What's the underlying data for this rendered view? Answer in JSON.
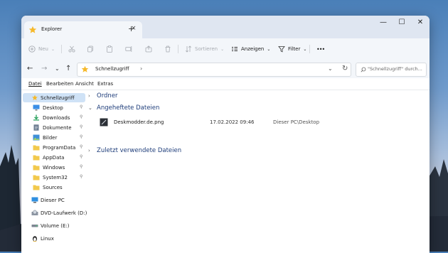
{
  "window": {
    "tab_title": "Explorer",
    "tab_close_glyph": "×",
    "new_tab_glyph": "+",
    "controls": {
      "minimize": "—",
      "maximize": "☐",
      "close": "✕"
    }
  },
  "toolbar": {
    "new_label": "Neu",
    "sort_label": "Sortieren",
    "view_label": "Anzeigen",
    "filter_label": "Filter",
    "more_label": "•••",
    "caret": "⌄"
  },
  "address": {
    "back": "←",
    "forward": "→",
    "dropdown": "⌄",
    "up": "↑",
    "path": "Schnellzugriff",
    "path_chevron": "›",
    "field_dropdown": "⌄",
    "refresh": "↻",
    "search_placeholder": "\"Schnellzugriff\" durch..."
  },
  "menubar": [
    "Datei",
    "Bearbeiten",
    "Ansicht",
    "Extras"
  ],
  "sidebar": {
    "quick_access": "Schnellzugriff",
    "pinned": [
      {
        "label": "Desktop",
        "icon": "desktop-icon"
      },
      {
        "label": "Downloads",
        "icon": "download-icon"
      },
      {
        "label": "Dokumente",
        "icon": "documents-icon"
      },
      {
        "label": "Bilder",
        "icon": "pictures-icon"
      },
      {
        "label": "ProgramData",
        "icon": "folder-icon"
      },
      {
        "label": "AppData",
        "icon": "folder-icon"
      },
      {
        "label": "Windows",
        "icon": "folder-icon"
      },
      {
        "label": "System32",
        "icon": "folder-icon"
      },
      {
        "label": "Sources",
        "icon": "folder-icon"
      }
    ],
    "pin_glyph": "📌",
    "this_pc": "Dieser PC",
    "dvd": "DVD-Laufwerk (D:) C",
    "volume": "Volume (E:)",
    "linux": "Linux"
  },
  "main": {
    "groups": {
      "ordner": "Ordner",
      "pinned": "Angeheftete Dateien",
      "recent": "Zuletzt verwendete Dateien"
    },
    "chev_right": "›",
    "chev_down": "⌄",
    "files": [
      {
        "name": "Deskmodder.de.png",
        "date": "17.02.2022 09:46",
        "location": "Dieser PC\\Desktop"
      }
    ]
  },
  "colors": {
    "accent": "#0067c0",
    "selection": "#cfe2f6",
    "folder": "#f2c94c",
    "star": "#f6b92b",
    "group_heading": "#1e3d7a"
  }
}
